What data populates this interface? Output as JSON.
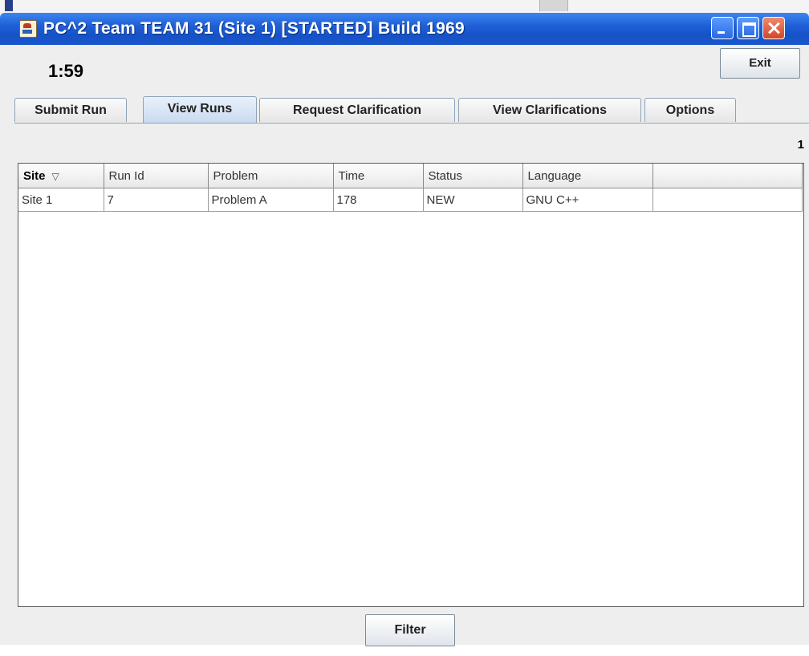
{
  "window": {
    "title": "PC^2 Team TEAM 31  (Site 1) [STARTED] Build 1969"
  },
  "header": {
    "clock": "1:59",
    "exit_label": "Exit"
  },
  "tabs": [
    {
      "label": "Submit Run",
      "active": false
    },
    {
      "label": "View Runs",
      "active": true
    },
    {
      "label": "Request Clarification",
      "active": false
    },
    {
      "label": "View Clarifications",
      "active": false
    },
    {
      "label": "Options",
      "active": false
    }
  ],
  "runs": {
    "count": "1",
    "columns": [
      "Site",
      "Run Id",
      "Problem",
      "Time",
      "Status",
      "Language",
      ""
    ],
    "sort_indicator": "▽",
    "rows": [
      [
        "Site 1",
        "7",
        "Problem A",
        "178",
        "NEW",
        "GNU C++",
        ""
      ]
    ]
  },
  "footer": {
    "filter_label": "Filter"
  },
  "colors": {
    "titlebar": "#1f5fd6",
    "active_tab": "#c8daf0",
    "panel": "#eeeeee"
  }
}
